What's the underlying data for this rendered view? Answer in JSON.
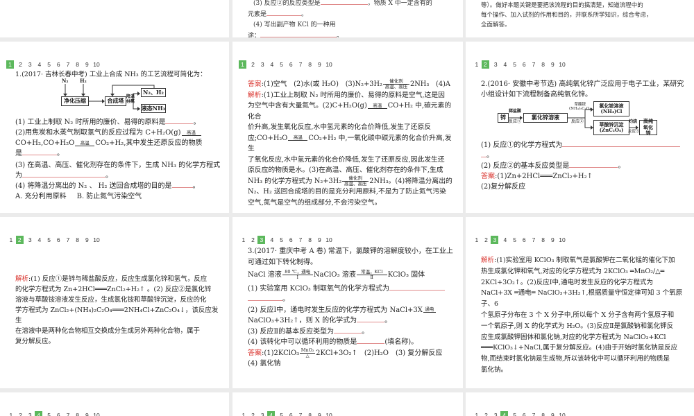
{
  "nav": [
    "1",
    "2",
    "3",
    "4",
    "5",
    "6",
    "7",
    "8",
    "9",
    "10"
  ],
  "top2": {
    "l1a": "(3) 反应②的反应类型是",
    "l1b": "，物质 X 中一定含有的",
    "l2": "元素是",
    "end": "。",
    "l3": "(4) 写出副产物 KCl 的一种用",
    "l4": "途："
  },
  "top3": {
    "lines": [
      "等）。做好本题关键是要把该流程的目的搞清楚，知道流程中的",
      "每个操作、加入试剂的作用和目的，并联系所学知识，综合考虑，",
      "全面解答。"
    ]
  },
  "q1": {
    "title": "1.(2017· 吉林长春中考) 工业上合成 NH₃ 的工艺流程可简化为：",
    "diagram": {
      "n2": "N₂",
      "h2": "H₂",
      "purify": "净化压缩",
      "tower": "合成塔",
      "cool": "降温",
      "sep": "分离",
      "recycle": "N₂、H₂",
      "liquid": "液态NH₃"
    },
    "p1": "(1) 工业上制取 N₂ 时所用的廉价、易得的原料是",
    "p2a": "(2)用焦炭和水蒸气制取氢气的反应过程为 C+H₂O(g)",
    "cond_high": "高温",
    "p2b": "CO+H₂,CO+H₂O",
    "p2c": "CO₂+H₂,其中发生还原反应的物质",
    "p2d": "是",
    "p3a": "(3) 在高温、高压、催化剂存在的条件下，生成 NH₃ 的化学方程式",
    "p3b": "为",
    "p4": "(4) 将降温分离出的 N₂ 、 H₂ 送回合成塔的目的是",
    "optA": "A. 充分利用原料",
    "optB": "B. 防止氮气污染空气",
    "end": "。"
  },
  "a1": {
    "ans_label": "答案",
    "ans_a": ":(1)空气　(2)水(或 H₂O)　(3)N₂+3H₂",
    "cat": "催化剂",
    "hp": "高温、高压",
    "ans_b": "2NH₃　(4)A",
    "exp_label": "解析",
    "e1": ":(1)工业上制取 N₂ 时所用的廉价、易得的原料是空气,这是因",
    "e2": "为空气中含有大量氮气。(2)C+H₂O(g)",
    "high": "高温",
    "e2b": "CO+H₂ 中,碳元素的化合",
    "e3": "价升高,发生氧化反应,水中氢元素的化合价降低,发生了还原反",
    "e4a": "应;CO+H₂O",
    "e4b": "CO₂+H₂ 中,一氧化碳中碳元素的化合价升高,发生",
    "e5": "了氧化反应,水中氢元素的化合价降低,发生了还原反应,因此发生还",
    "e6": "原反应的物质是水。(3)在高温、高压、催化剂存在的条件下,生成",
    "e7a": "NH₃ 的化学方程式为 N₂+3H₂",
    "e7b": "2NH₃。(4)将降温分离出的",
    "e8": "N₂、H₂ 送回合成塔的目的是充分利用原料,不是为了防止氮气污染",
    "e9": "空气,氮气是空气的组成部分,不会污染空气。"
  },
  "q2": {
    "title1": "2.(2016· 安徽中考节选) 高纯氧化锌广泛应用于电子工业，某研究",
    "title2": "小组设计如下流程制备高纯氧化锌。",
    "diagram": {
      "zn": "锌",
      "hcl": "稀盐酸",
      "r1": "反应①",
      "zncl2": "氯化锌溶液",
      "ox": "草酸铵",
      "oxf": "(NH₄)₂C₂O₄",
      "r2": "反应②",
      "nh4cl": "氯化铵溶液",
      "nh4clf": "(NH₄)Cl",
      "znox": "草酸锌沉淀",
      "znoxf": "(ZnC₂O₄)",
      "burn": "灼烧",
      "r3": "反应③",
      "zno": "高纯氧化锌"
    },
    "p1": "(1) 反应①的化学方程式为",
    "p1b": "。",
    "p2": "(2) 反应②的基本反应类型是",
    "end": "。",
    "ans_label": "答案",
    "ans1": ":(1)Zn+2HCl═══ZnCl₂+H₂↑",
    "ans2": "(2)复分解反应"
  },
  "a2": {
    "exp_label": "解析",
    "lines": [
      ":(1) 反应①是锌与稀盐酸反应，反应生成氯化锌和氢气，反应",
      "的化学方程式为 Zn+2HCl═══ZnCl₂+H₂↑ 。(2) 反应②是氯化锌",
      "溶液与草酸铵溶液发生反应，生成氯化铵和草酸锌沉淀，反应的化",
      "学方程式为 ZnCl₂+(NH₄)₂C₂O₄═══2NH₄Cl+ZnC₂O₄↓，该反应发生",
      "在溶液中是两种化合物相互交换成分生成另外两种化合物，属于",
      "复分解反应。"
    ]
  },
  "q3": {
    "title1": "3.(2017· 重庆中考 A 卷) 常温下，氯酸钾的溶解度较小，在工业上",
    "title2": "可通过如下转化制得。",
    "f1": "NaCl 溶液",
    "c1t": "80 ℃，通电",
    "c1b": "Ⅰ",
    "f2": "NaClO₃ 溶液",
    "c2t": "常温，KCl",
    "c2b": "Ⅱ",
    "f3": "KClO₃ 固体",
    "p1": "(1) 实验室用 KClO₃ 制取氧气的化学方程式为",
    "p2a": "(2) 反应Ⅰ中，通电时发生反应的化学方程式为 NaCl+3X",
    "elec": "通电",
    "p2b": "NaClO₃+3H₂↑，则 X 的化学式为",
    "p3": "(3) 反应Ⅱ的基本反应类型为",
    "p4a": "(4) 该转化中可以循环利用的物质是",
    "p4b": "(填名称)。",
    "end": "。",
    "ans_label": "答案",
    "ans_a": ":(1)2KClO₃",
    "mno2": "MnO₂",
    "delta": "△",
    "ans_b": "2KCl+3O₂↑　(2)H₂O　(3) 复分解反应",
    "ans_c": "(4) 氯化钠"
  },
  "a3": {
    "exp_label": "解析",
    "lines": [
      ":(1)实验室用 KClO₃ 制取氧气是氯酸钾在二氧化锰的催化下加",
      "热生成氯化钾和氧气,对应的化学方程式为 2KClO₃ ═MnO₂/△═",
      "2KCl+3O₂↑。(2)反应Ⅰ中,通电时发生反应的化学方程式为",
      "NaCl+3X ═通电═ NaClO₃+3H₂↑,根据质量守恒定律可知 3 个氧原子、6",
      "个氢原子分布在 3 个 X 分子中,所以每个 X 分子含有两个氢原子和",
      "一个氧原子,则 X 的化学式为 H₂O。(3)反应Ⅱ是氯酸钠和氯化钾反",
      "应生成氯酸钾固体和氯化钠,对应的化学方程式为 NaClO₃+KCl",
      "═══KClO₃↓+NaCl,属于复分解反应。(4)由于开始时氯化钠是反应",
      "物,而结束时氯化钠是生成物,所以该转化中可以循环利用的物质是",
      "氯化钠。"
    ]
  },
  "active": {
    "q1": 1,
    "a1": 1,
    "q2": 2,
    "a2": 2,
    "q3": 3,
    "a3": 3,
    "r4": 4
  },
  "accent": "#5cb85c"
}
